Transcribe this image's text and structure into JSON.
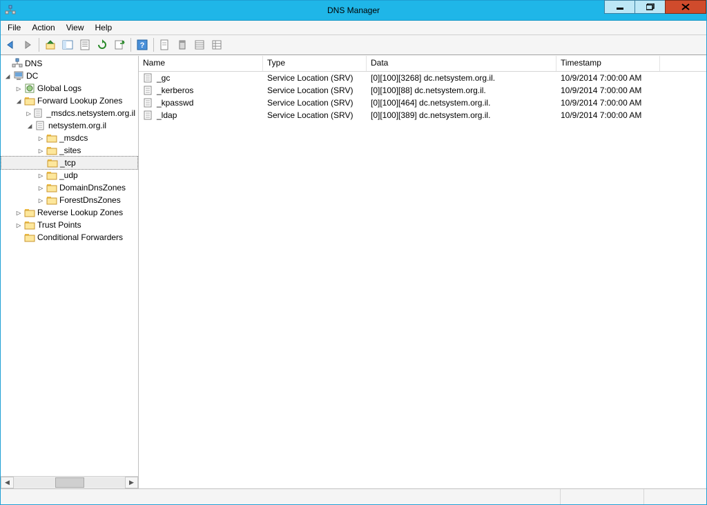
{
  "title": "DNS Manager",
  "menu": {
    "file": "File",
    "action": "Action",
    "view": "View",
    "help": "Help"
  },
  "tree": {
    "root": "DNS",
    "server": "DC",
    "global_logs": "Global Logs",
    "flz": "Forward Lookup Zones",
    "zone_msdcs": "_msdcs.netsystem.org.il",
    "zone_main": "netsystem.org.il",
    "sub_msdcs": "_msdcs",
    "sub_sites": "_sites",
    "sub_tcp": "_tcp",
    "sub_udp": "_udp",
    "sub_ddz": "DomainDnsZones",
    "sub_fdz": "ForestDnsZones",
    "rlz": "Reverse Lookup Zones",
    "tp": "Trust Points",
    "cf": "Conditional Forwarders"
  },
  "columns": {
    "name": "Name",
    "type": "Type",
    "data": "Data",
    "timestamp": "Timestamp"
  },
  "records": [
    {
      "name": "_gc",
      "type": "Service Location (SRV)",
      "data": "[0][100][3268] dc.netsystem.org.il.",
      "timestamp": "10/9/2014 7:00:00 AM"
    },
    {
      "name": "_kerberos",
      "type": "Service Location (SRV)",
      "data": "[0][100][88] dc.netsystem.org.il.",
      "timestamp": "10/9/2014 7:00:00 AM"
    },
    {
      "name": "_kpasswd",
      "type": "Service Location (SRV)",
      "data": "[0][100][464] dc.netsystem.org.il.",
      "timestamp": "10/9/2014 7:00:00 AM"
    },
    {
      "name": "_ldap",
      "type": "Service Location (SRV)",
      "data": "[0][100][389] dc.netsystem.org.il.",
      "timestamp": "10/9/2014 7:00:00 AM"
    }
  ],
  "col_widths": {
    "name": 180,
    "type": 150,
    "data": 275,
    "timestamp": 150
  }
}
